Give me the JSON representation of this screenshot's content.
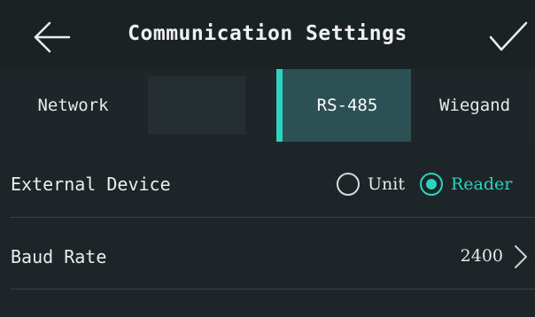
{
  "header": {
    "title": "Communication Settings",
    "back_icon": "arrow-left-icon",
    "confirm_icon": "checkmark-icon"
  },
  "tabs": [
    {
      "label": "Network",
      "selected": false
    },
    {
      "label": "",
      "selected": false
    },
    {
      "label": "RS-485",
      "selected": true
    },
    {
      "label": "Wiegand",
      "selected": false
    }
  ],
  "settings": {
    "external_device": {
      "label": "External Device",
      "options": [
        {
          "label": "Unit",
          "selected": false
        },
        {
          "label": "Reader",
          "selected": true
        }
      ]
    },
    "baud_rate": {
      "label": "Baud Rate",
      "value": "2400",
      "icon": "chevron-right-icon"
    }
  },
  "colors": {
    "accent": "#2bd4bf",
    "background": "#1e2528",
    "selected_tab": "#2b5155"
  }
}
